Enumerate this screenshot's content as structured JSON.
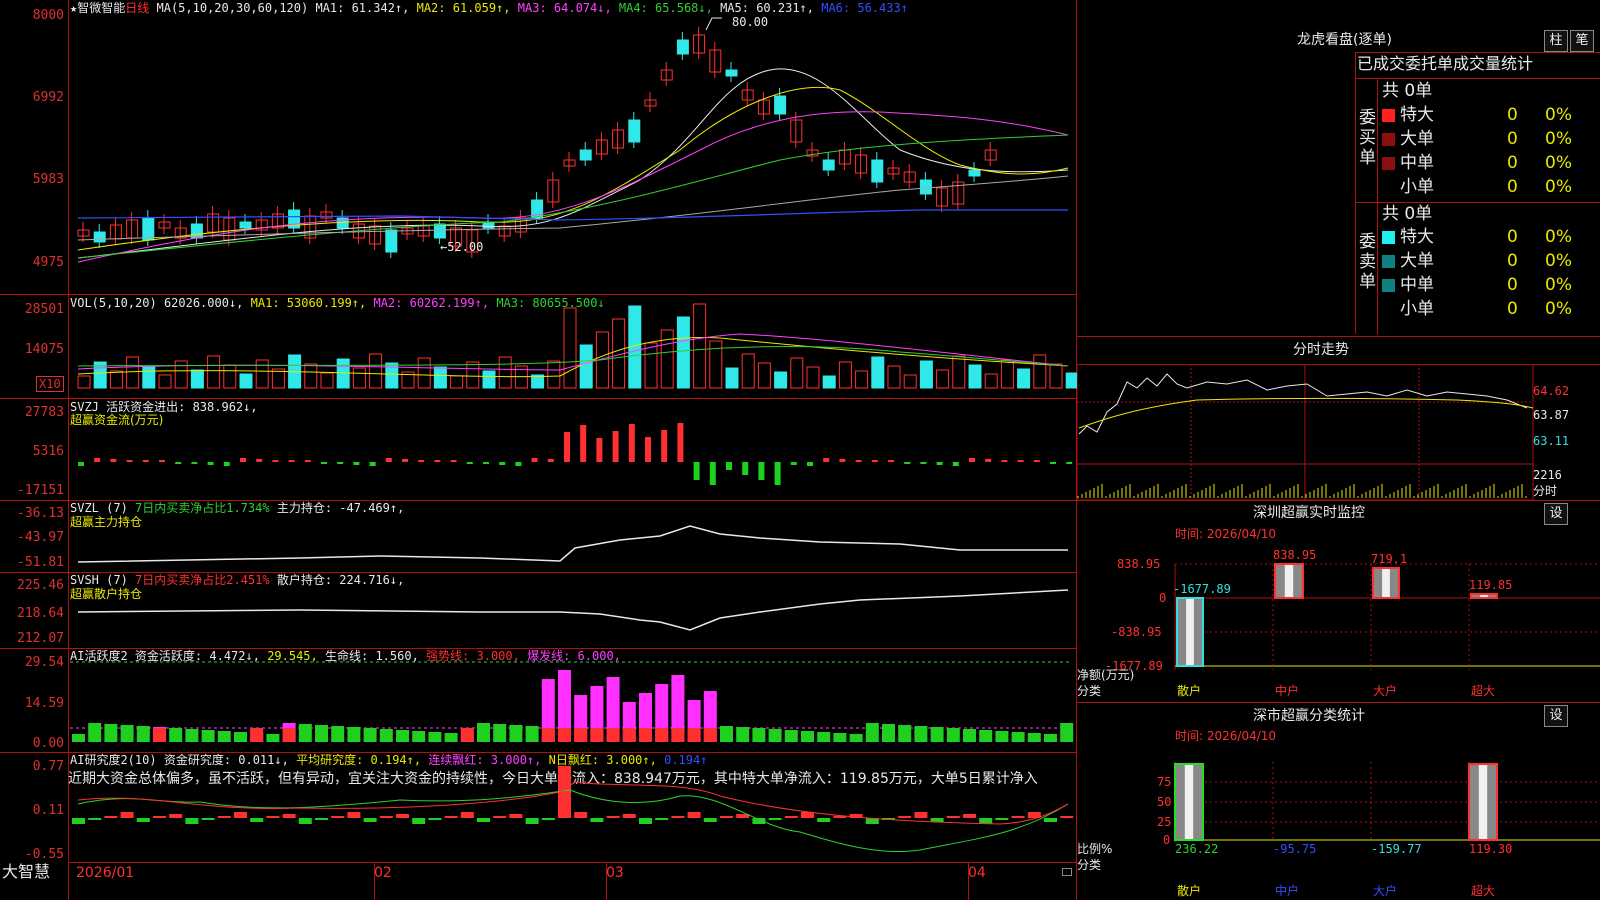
{
  "header": {
    "star": "★",
    "stock_name": "智微智能",
    "period": "日线",
    "ma_label": "MA(5,10,20,30,60,120)",
    "ma1": "MA1: 61.342↑,",
    "ma2": "MA2: 61.059↑,",
    "ma3": "MA3: 64.074↓,",
    "ma4": "MA4: 65.568↓,",
    "ma5": "MA5: 60.231↑,",
    "ma6": "MA6: 56.433↑"
  },
  "colors": {
    "up": "#ff3030",
    "down": "#30e8e8",
    "axis": "#b01010",
    "ma1": "#e8e8e8",
    "ma2": "#e8e800",
    "ma3": "#ff40ff",
    "ma4": "#30d030",
    "ma5": "#aaaaaa",
    "ma6": "#3050ff"
  },
  "price_axis": [
    "8000",
    "6992",
    "5983",
    "4975"
  ],
  "price_annotations": {
    "high": "80.00",
    "low": "←52.00"
  },
  "vol": {
    "label": "VOL(5,10,20)",
    "value": "62026.000↓,",
    "ma1": "MA1: 53060.199↑,",
    "ma2": "MA2: 60262.199↑,",
    "ma3": "MA3: 80655.500↓",
    "axis": [
      "28501",
      "14075"
    ],
    "unit": "X10"
  },
  "svzj": {
    "label": "SVZJ  活跃资金进出: 838.962↓,",
    "title": "超赢资金流(万元)",
    "axis": [
      "27783",
      "5316",
      "-17151"
    ]
  },
  "svzl": {
    "label": "SVZL  (7)",
    "l2": "7日内买卖净占比1.734%",
    "l3": "主力持仓: -47.469↑,",
    "title": "超赢主力持仓",
    "axis": [
      "-36.13",
      "-43.97",
      "-51.81"
    ]
  },
  "svsh": {
    "label": "SVSH  (7)",
    "l2": "7日内买卖净占比2.451%",
    "l3": "散户持仓: 224.716↓,",
    "title": "超赢散户持仓",
    "axis": [
      "225.46",
      "218.64",
      "212.07"
    ]
  },
  "ai1": {
    "label": "AI活跃度2",
    "l2": "资金活跃度: 4.472↓,",
    "l3": "29.545,",
    "l4": "生命线: 1.560,",
    "l5": "强势线: 3.000,",
    "l6": "爆发线: 6.000,",
    "axis": [
      "29.54",
      "14.59",
      "0.00"
    ]
  },
  "ai2": {
    "label": "AI研究度2(10)",
    "l2": "资金研究度: 0.011↓,",
    "l3": "平均研究度: 0.194↑,",
    "l4": "连续飘红: 3.000↑,",
    "l5": "N日飘红: 3.000↑,",
    "l6": "0.194↑",
    "comment": "近期大资金总体偏多，虽不活跃，但有异动，宜关注大资金的持续性，今日大单净流入：838.947万元，其中特大单净流入：119.85万元，大单5日累计净入",
    "axis": [
      "0.77",
      "0.11",
      "-0.55"
    ]
  },
  "xaxis": {
    "brand": "大智慧",
    "labels": [
      "2026/01",
      "02",
      "03",
      "04"
    ]
  },
  "right": {
    "dragon_title": "龙虎看盘(逐单)",
    "btn_zhu": "柱",
    "btn_bi": "笔",
    "table_header": "已成交委托单成交量统计",
    "buy_label": "委买单",
    "sell_label": "委卖单",
    "buy_total": "共 0单",
    "sell_total": "共 0单",
    "buy_rows": [
      {
        "name": "特大",
        "v": "0",
        "p": "0%",
        "color": "#ff2020"
      },
      {
        "name": "大单",
        "v": "0",
        "p": "0%",
        "color": "#8a1010"
      },
      {
        "name": "中单",
        "v": "0",
        "p": "0%",
        "color": "#8a1010"
      },
      {
        "name": "小单",
        "v": "0",
        "p": "0%",
        "color": ""
      }
    ],
    "sell_rows": [
      {
        "name": "特大",
        "v": "0",
        "p": "0%",
        "color": "#20f0f0"
      },
      {
        "name": "大单",
        "v": "0",
        "p": "0%",
        "color": "#108080"
      },
      {
        "name": "中单",
        "v": "0",
        "p": "0%",
        "color": "#108080"
      },
      {
        "name": "小单",
        "v": "0",
        "p": "0%",
        "color": ""
      }
    ],
    "intraday_title": "分时走势",
    "intraday_axis": [
      "64.62",
      "63.87",
      "63.11"
    ],
    "intraday_vol": "2216",
    "intraday_unit": "分时",
    "monitor_title": "深圳超赢实时监控",
    "monitor_time": "时间: 2026/04/10",
    "settings": "设",
    "monitor_axis": [
      "838.95",
      "0",
      "-838.95",
      "-1677.89"
    ],
    "monitor_bar_labels": [
      "-1677.89",
      "838.95",
      "719.1",
      "119.85"
    ],
    "monitor_ylabel": "净额(万元)",
    "monitor_xlabel": "分类",
    "categories": [
      "散户",
      "中户",
      "大户",
      "超大"
    ],
    "class_title": "深市超赢分类统计",
    "class_time": "时间: 2026/04/10",
    "class_axis": [
      "75",
      "50",
      "25",
      "0"
    ],
    "class_bar_labels": [
      "236.22",
      "-95.75",
      "-159.77",
      "119.30"
    ],
    "class_ylabel": "比例%",
    "class_xlabel": "分类"
  }
}
